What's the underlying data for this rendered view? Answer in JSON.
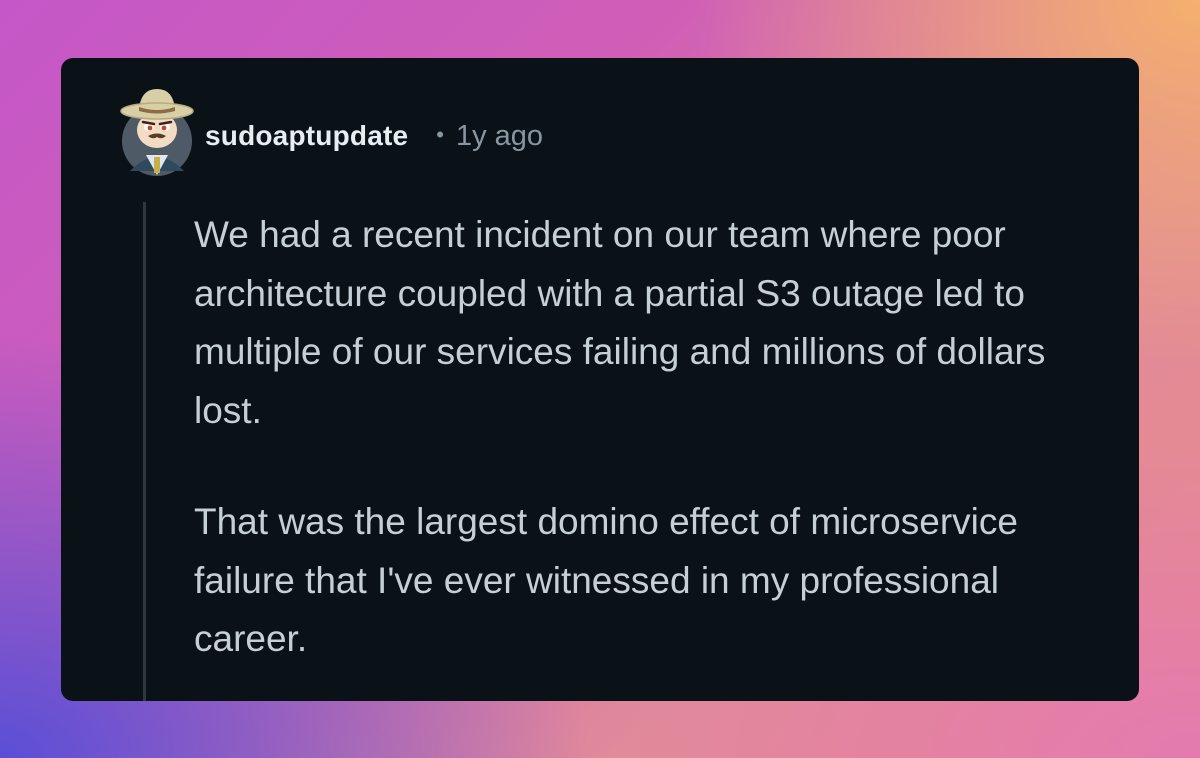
{
  "comment": {
    "username": "sudoaptupdate",
    "separator": "•",
    "timestamp": "1y ago",
    "avatar_icon": "snoo-cowboy-avatar-icon",
    "paragraphs": [
      "We had a recent incident on our team where poor architecture coupled with a partial S3 outage led to multiple of our services failing and millions of dollars lost.",
      "That was the largest domino effect of microservice failure that I've ever witnessed in my professional career."
    ]
  },
  "colors": {
    "card_background": "#0b1217",
    "username": "#e8edf1",
    "meta": "#8796a1",
    "body_text": "#c5cfd6",
    "thread_line": "#2d3840"
  }
}
